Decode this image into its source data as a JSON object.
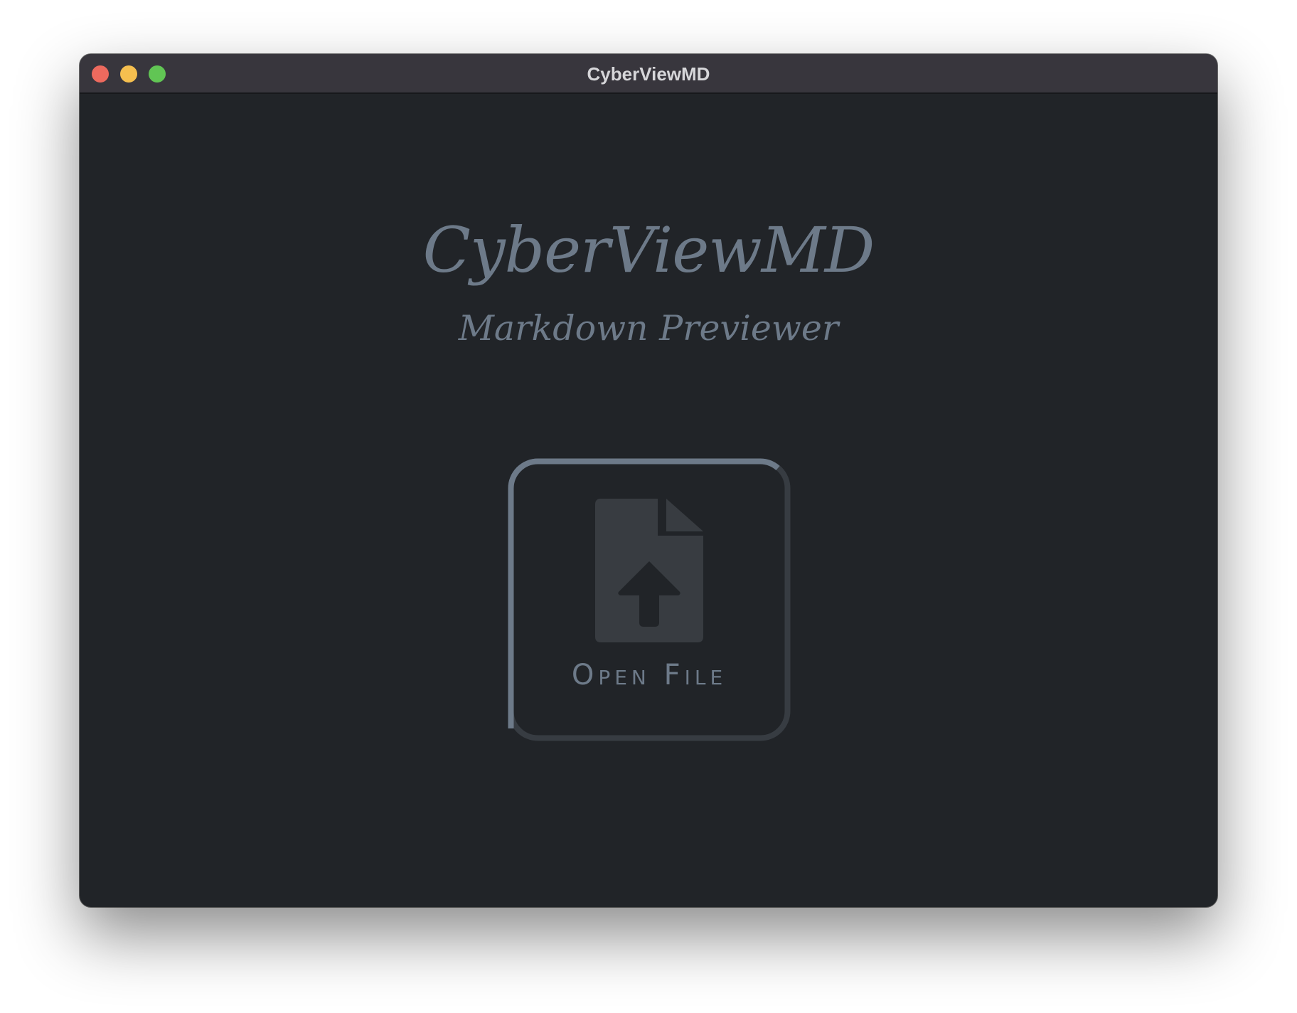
{
  "window": {
    "title": "CyberViewMD"
  },
  "app": {
    "title": "CyberViewMD",
    "subtitle": "Markdown Previewer"
  },
  "open_file": {
    "label": "Open File",
    "icon": "file-upload-icon"
  },
  "colors": {
    "window_background": "#212428",
    "titlebar_background": "#38363d",
    "accent_text": "#6d7a89",
    "button_ring_light": "#6d7a89",
    "button_ring_dark": "#373c42",
    "icon_fill": "#383c41",
    "traffic_close": "#ed6a5e",
    "traffic_minimize": "#f5bf4f",
    "traffic_zoom": "#61c554"
  }
}
